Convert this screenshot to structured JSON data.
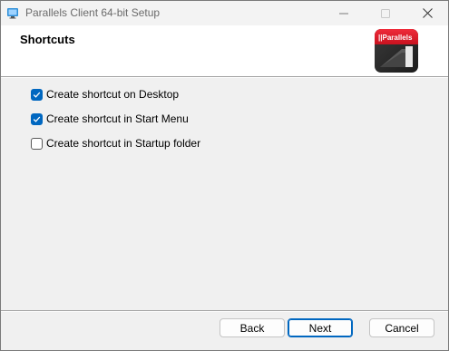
{
  "window": {
    "title": "Parallels Client 64-bit Setup"
  },
  "banner": {
    "title": "Shortcuts",
    "logo_text": "||Parallels"
  },
  "options": [
    {
      "label": "Create shortcut on Desktop",
      "checked": true
    },
    {
      "label": "Create shortcut in Start Menu",
      "checked": true
    },
    {
      "label": "Create shortcut in Startup folder",
      "checked": false
    }
  ],
  "buttons": {
    "back": "Back",
    "next": "Next",
    "cancel": "Cancel"
  },
  "colors": {
    "accent": "#0067c0",
    "logo_red": "#e01c2c"
  }
}
